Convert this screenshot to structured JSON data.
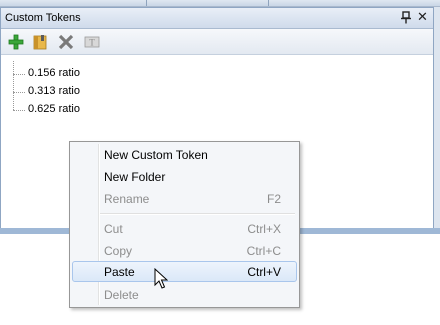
{
  "panel": {
    "title": "Custom Tokens",
    "pin_icon": "pin-icon",
    "close_label": "✕"
  },
  "toolbar": {
    "icons": [
      "add-icon",
      "folder-icon",
      "delete-icon",
      "rename-icon"
    ]
  },
  "tree": {
    "items": [
      {
        "label": "0.156 ratio"
      },
      {
        "label": "0.313 ratio"
      },
      {
        "label": "0.625 ratio"
      }
    ]
  },
  "context_menu": {
    "items": [
      {
        "label": "New Custom Token",
        "shortcut": "",
        "enabled": true
      },
      {
        "label": "New Folder",
        "shortcut": "",
        "enabled": true
      },
      {
        "label": "Rename",
        "shortcut": "F2",
        "enabled": false
      },
      {
        "label": "Cut",
        "shortcut": "Ctrl+X",
        "enabled": false
      },
      {
        "label": "Copy",
        "shortcut": "Ctrl+C",
        "enabled": false
      },
      {
        "label": "Paste",
        "shortcut": "Ctrl+V",
        "enabled": true,
        "highlighted": true
      },
      {
        "label": "Delete",
        "shortcut": "",
        "enabled": false
      }
    ]
  },
  "colors": {
    "panel_border": "#8fa6c3",
    "highlight_border": "#a9c6ec",
    "disabled_text": "#8d8d8d",
    "add_green": "#3aa63a"
  }
}
